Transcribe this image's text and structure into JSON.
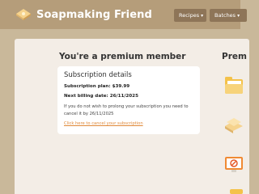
{
  "brand": {
    "name": "Soapmaking Friend",
    "logo_icon": "soap-bar-icon"
  },
  "nav": [
    {
      "label": "Recipes",
      "icon": "chevron-down-icon"
    },
    {
      "label": "Batches",
      "icon": "chevron-down-icon"
    }
  ],
  "main": {
    "heading": "You're a premium member",
    "side_heading": "Prem"
  },
  "subscription": {
    "title": "Subscription details",
    "plan": "Subscription plan: $39.99",
    "next_billing": "Next billing date: 26/11/2025",
    "note": "If you do not wish to prolong your subscription you need to cancel it by 26/11/2025",
    "cancel_link": "Click here to cancel your subscription"
  },
  "colors": {
    "topbar": "#b59d7a",
    "accent": "#e08a3a",
    "panel": "#f3ede6"
  },
  "side_illustrations": [
    "folder-icon",
    "soap-stack-icon",
    "monitor-icon"
  ]
}
